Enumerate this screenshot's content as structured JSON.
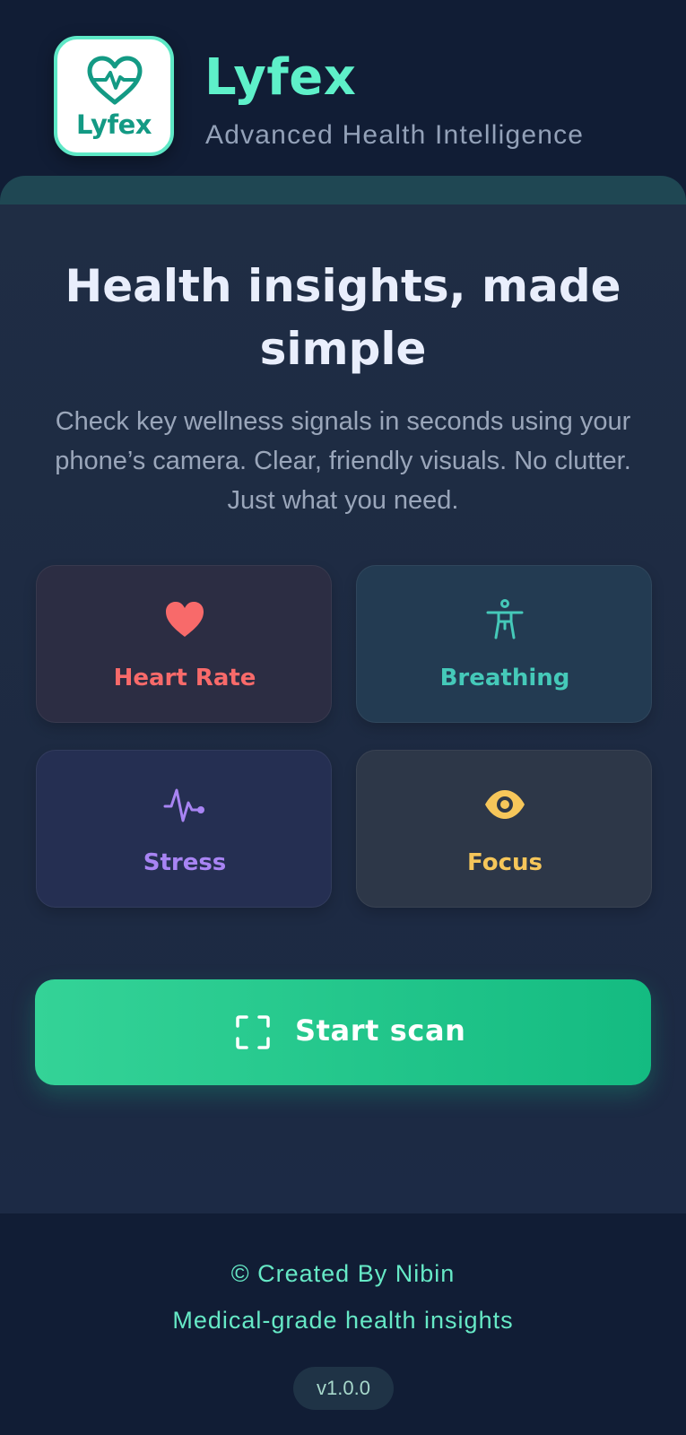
{
  "header": {
    "logo_text": "Lyfex",
    "brand_name": "Lyfex",
    "tagline": "Advanced Health Intelligence"
  },
  "hero": {
    "title": "Health insights, made simple",
    "subtitle": "Check key wellness signals in seconds using your phone’s camera. Clear, friendly visuals. No clutter. Just what you need."
  },
  "metrics": [
    {
      "label": "Heart Rate",
      "icon": "heart-icon",
      "color": "#f86a6a"
    },
    {
      "label": "Breathing",
      "icon": "person-icon",
      "color": "#45c9b9"
    },
    {
      "label": "Stress",
      "icon": "pulse-icon",
      "color": "#a884f3"
    },
    {
      "label": "Focus",
      "icon": "eye-icon",
      "color": "#f6c65a"
    }
  ],
  "scan_button": {
    "label": "Start scan",
    "icon": "scan-frame-icon"
  },
  "footer": {
    "credit": "© Created By Nibin",
    "tagline": "Medical-grade health insights",
    "version": "v1.0.0"
  },
  "colors": {
    "accent": "#5ef0c9",
    "scan_gradient_start": "#34d397",
    "scan_gradient_end": "#14bb81",
    "background": "#111d35"
  }
}
